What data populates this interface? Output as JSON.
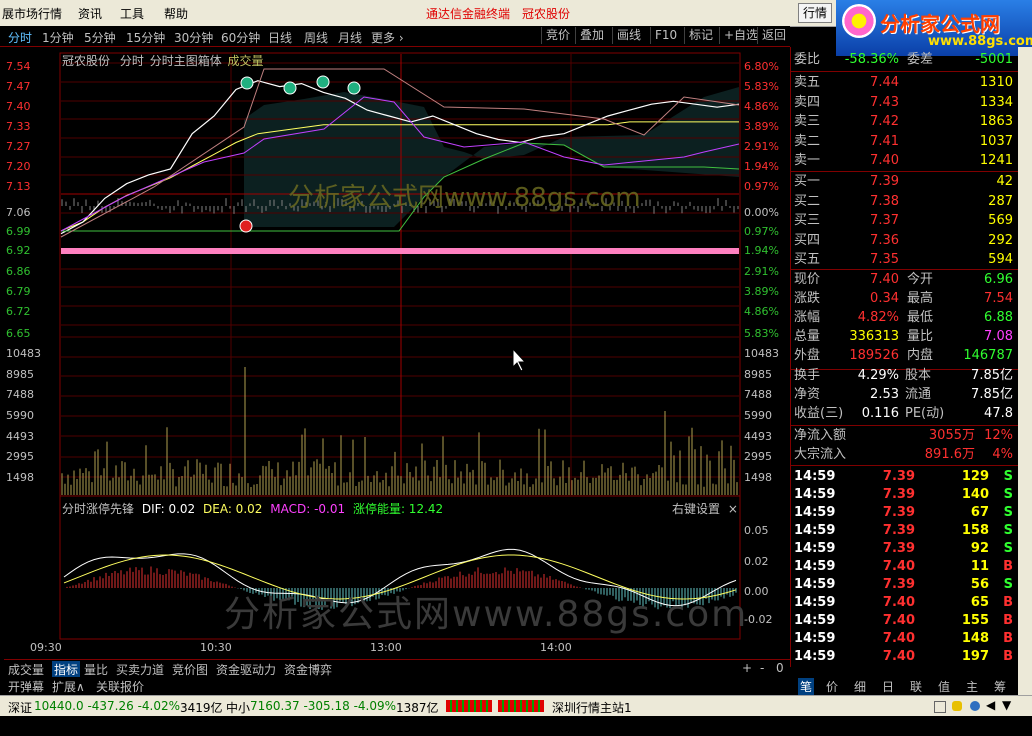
{
  "menu": {
    "items": [
      "展市场行情",
      "资讯",
      "工具",
      "帮助"
    ],
    "title_red_1": "通达信金融终端",
    "title_red_2": "冠农股份",
    "hq_button": "行情"
  },
  "logo": {
    "text": "分析家公式网",
    "url": "www.88gs.com"
  },
  "toolbar": {
    "periods": [
      "分时",
      "1分钟",
      "5分钟",
      "15分钟",
      "30分钟",
      "60分钟",
      "日线",
      "周线",
      "月线",
      "更多 ›"
    ],
    "buttons": [
      "竞价",
      "叠加",
      "画线",
      "F10",
      "标记",
      "+自选",
      "返回"
    ]
  },
  "chart_header": {
    "stock": "冠农股份",
    "mode": "分时",
    "indicator": "分时主图箱体",
    "volume": "成交量"
  },
  "watermark": "分析家公式网www.88gs.com",
  "price_axis_left": [
    "7.54",
    "7.47",
    "7.40",
    "7.33",
    "7.27",
    "7.20",
    "7.13",
    "7.06",
    "6.99",
    "6.92",
    "6.86",
    "6.79",
    "6.72",
    "6.65"
  ],
  "price_axis_right": [
    "6.80%",
    "5.83%",
    "4.86%",
    "3.89%",
    "2.91%",
    "1.94%",
    "0.97%",
    "0.00%",
    "0.97%",
    "1.94%",
    "2.91%",
    "3.89%",
    "4.86%",
    "5.83%"
  ],
  "volume_axis": [
    "10483",
    "8985",
    "7488",
    "5990",
    "4493",
    "2995",
    "1498"
  ],
  "macd": {
    "title": "分时涨停先锋",
    "dif": "DIF: 0.02",
    "dea": "DEA: 0.02",
    "macd": "MACD: -0.01",
    "energy": "涨停能量: 12.42",
    "settings": "右键设置",
    "axis": [
      "0.05",
      "0.02",
      "0.00",
      "-0.02"
    ]
  },
  "time_axis": [
    "09:30",
    "10:30",
    "13:00",
    "14:00"
  ],
  "chart_data": {
    "type": "line",
    "title": "冠农股份 分时",
    "prev_close": 7.06,
    "ylim": [
      6.65,
      7.54
    ],
    "price": [
      6.96,
      7.0,
      7.08,
      7.13,
      7.16,
      7.18,
      7.3,
      7.36,
      7.45,
      7.48,
      7.46,
      7.47,
      7.44,
      7.42,
      7.38,
      7.36,
      7.34,
      7.36,
      7.33,
      7.3,
      7.28,
      7.27,
      7.29,
      7.3,
      7.33,
      7.36,
      7.38,
      7.4,
      7.41,
      7.4,
      7.39,
      7.4
    ],
    "avg": [
      6.97,
      7.0,
      7.05,
      7.09,
      7.12,
      7.15,
      7.19,
      7.23,
      7.27,
      7.3,
      7.31,
      7.32,
      7.33,
      7.33,
      7.33,
      7.33,
      7.33,
      7.33,
      7.33,
      7.33,
      7.33,
      7.33,
      7.33,
      7.33,
      7.33,
      7.33,
      7.34,
      7.34,
      7.34,
      7.34,
      7.34,
      7.34
    ]
  },
  "bottom_tabs": [
    "成交量",
    "指标",
    "量比",
    "买卖力道",
    "竞价图",
    "资金驱动力",
    "资金博弈"
  ],
  "bottom_tabs2": [
    "开弹幕",
    "扩展∧",
    "关联报价"
  ],
  "bottom_controls": [
    "+",
    "-",
    "0"
  ],
  "order_book": {
    "header": {
      "k1": "委比",
      "v1": "-58.36%",
      "k2": "委差",
      "v2": "-5001"
    },
    "asks": [
      {
        "label": "卖五",
        "price": "7.44",
        "vol": "1310"
      },
      {
        "label": "卖四",
        "price": "7.43",
        "vol": "1334"
      },
      {
        "label": "卖三",
        "price": "7.42",
        "vol": "1863"
      },
      {
        "label": "卖二",
        "price": "7.41",
        "vol": "1037"
      },
      {
        "label": "卖一",
        "price": "7.40",
        "vol": "1241"
      }
    ],
    "bids": [
      {
        "label": "买一",
        "price": "7.39",
        "vol": "42"
      },
      {
        "label": "买二",
        "price": "7.38",
        "vol": "287"
      },
      {
        "label": "买三",
        "price": "7.37",
        "vol": "569"
      },
      {
        "label": "买四",
        "price": "7.36",
        "vol": "292"
      },
      {
        "label": "买五",
        "price": "7.35",
        "vol": "594"
      }
    ]
  },
  "quote": [
    {
      "k1": "现价",
      "v1": "7.40",
      "c1": "#ff3030",
      "k2": "今开",
      "v2": "6.96",
      "c2": "#30ff30"
    },
    {
      "k1": "涨跌",
      "v1": "0.34",
      "c1": "#ff3030",
      "k2": "最高",
      "v2": "7.54",
      "c2": "#ff3030"
    },
    {
      "k1": "涨幅",
      "v1": "4.82%",
      "c1": "#ff3030",
      "k2": "最低",
      "v2": "6.88",
      "c2": "#30ff30"
    },
    {
      "k1": "总量",
      "v1": "336313",
      "c1": "#ffff00",
      "k2": "量比",
      "v2": "7.08",
      "c2": "#ff40ff"
    },
    {
      "k1": "外盘",
      "v1": "189526",
      "c1": "#ff3030",
      "k2": "内盘",
      "v2": "146787",
      "c2": "#30ff30"
    }
  ],
  "fundamentals": [
    {
      "k1": "换手",
      "v1": "4.29%",
      "k2": "股本",
      "v2": "7.85亿"
    },
    {
      "k1": "净资",
      "v1": "2.53",
      "k2": "流通",
      "v2": "7.85亿"
    },
    {
      "k1": "收益(三)",
      "v1": "0.116",
      "k2": "PE(动)",
      "v2": "47.8"
    }
  ],
  "flows": [
    {
      "k": "净流入额",
      "v": "3055万",
      "p": "12%"
    },
    {
      "k": "大宗流入",
      "v": "891.6万",
      "p": "4%"
    }
  ],
  "ticks": [
    {
      "t": "14:59",
      "p": "7.39",
      "v": "129",
      "s": "S"
    },
    {
      "t": "14:59",
      "p": "7.39",
      "v": "140",
      "s": "S"
    },
    {
      "t": "14:59",
      "p": "7.39",
      "v": "67",
      "s": "S"
    },
    {
      "t": "14:59",
      "p": "7.39",
      "v": "158",
      "s": "S"
    },
    {
      "t": "14:59",
      "p": "7.39",
      "v": "92",
      "s": "S"
    },
    {
      "t": "14:59",
      "p": "7.40",
      "v": "11",
      "s": "B"
    },
    {
      "t": "14:59",
      "p": "7.39",
      "v": "56",
      "s": "S"
    },
    {
      "t": "14:59",
      "p": "7.40",
      "v": "65",
      "s": "B"
    },
    {
      "t": "14:59",
      "p": "7.40",
      "v": "155",
      "s": "B"
    },
    {
      "t": "14:59",
      "p": "7.40",
      "v": "148",
      "s": "B"
    },
    {
      "t": "14:59",
      "p": "7.40",
      "v": "197",
      "s": "B"
    }
  ],
  "right_tabs": [
    "笔",
    "价",
    "细",
    "日",
    "联",
    "值",
    "主",
    "筹"
  ],
  "status": {
    "sz_label": "深证",
    "sz_value": "10440.0 -437.26 -4.02%",
    "sz_amount": "3419亿",
    "zx_label": "中小",
    "zx_value": "7160.37 -305.18 -4.09%",
    "zx_amount": "1387亿",
    "server": "深圳行情主站1"
  }
}
